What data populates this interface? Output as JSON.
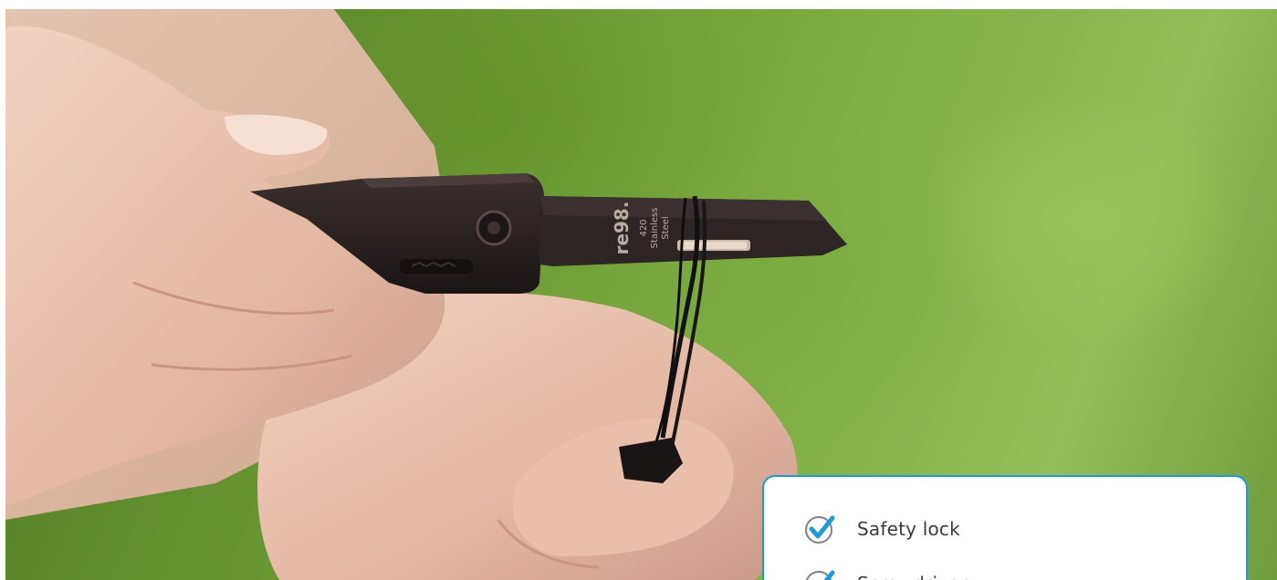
{
  "hero": {
    "image_label": "hands holding black folding utility knife with lanyard"
  },
  "blade": {
    "brand": "re98.",
    "line1": "420",
    "line2": "Stainless",
    "line3": "Steel"
  },
  "features": {
    "items": [
      {
        "label": "Safety lock",
        "icon": "check-circle-icon"
      },
      {
        "label": "Screwdriver",
        "icon": "check-circle-icon"
      }
    ],
    "accent_color": "#1e9ad6"
  }
}
